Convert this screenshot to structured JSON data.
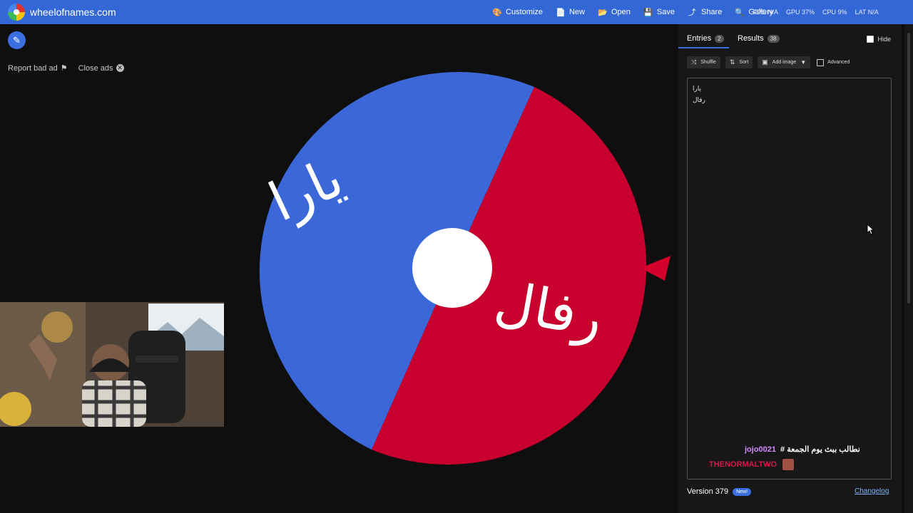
{
  "header": {
    "brand": "wheelofnames.com",
    "menu": [
      {
        "icon": "palette-icon",
        "glyph": "🎨",
        "label": "Customize"
      },
      {
        "icon": "file-icon",
        "glyph": "📄",
        "label": "New"
      },
      {
        "icon": "folder-open-icon",
        "glyph": "📂",
        "label": "Open"
      },
      {
        "icon": "save-icon",
        "glyph": "💾",
        "label": "Save"
      },
      {
        "icon": "share-icon",
        "glyph": "⤴",
        "label": "Share"
      },
      {
        "icon": "search-icon",
        "glyph": "🔍",
        "label": "Gallery"
      }
    ],
    "stats": [
      "FPS N/A",
      "GPU 37%",
      "CPU 9%",
      "LAT N/A"
    ]
  },
  "ads": {
    "report_label": "Report bad ad",
    "close_label": "Close ads"
  },
  "wheel": {
    "entries": [
      {
        "text": "يارا",
        "color": "#3b67d9"
      },
      {
        "text": "رفال",
        "color": "#c8002e"
      }
    ],
    "hub_color": "#ffffff",
    "pointer_color": "#d6002d"
  },
  "panel": {
    "tabs": [
      {
        "label": "Entries",
        "count": "2"
      },
      {
        "label": "Results",
        "count": "38"
      }
    ],
    "hide_label": "Hide",
    "toolbar": {
      "shuffle": "Shuffle",
      "sort": "Sort",
      "add_image": "Add image",
      "advanced": "Advanced"
    },
    "entries": [
      "يارا",
      "رفال"
    ],
    "chat": [
      {
        "user": "jojo0021",
        "message": "# نطالب ببث يوم الجمعة",
        "user_color": "#d18bff"
      },
      {
        "user": "THENORMALTWO",
        "message": "",
        "user_color": "#d6174a"
      }
    ],
    "version_label": "Version 379",
    "new_badge": "New!",
    "changelog_label": "Changelog"
  }
}
